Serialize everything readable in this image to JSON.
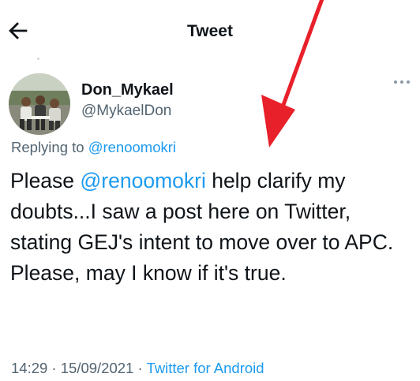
{
  "header": {
    "title": "Tweet",
    "back_icon": "back-arrow-icon"
  },
  "author": {
    "name": "Don_Mykael",
    "handle": "@MykaelDon",
    "avatar": "avatar-photo"
  },
  "more_icon": "more-options-icon",
  "reply": {
    "prefix": "Replying to ",
    "mention": "@renoomokri"
  },
  "tweet": {
    "pre": "Please ",
    "mention": "@renoomokri",
    "post": " help clarify my doubts...I saw a post here on Twitter, stating GEJ's intent to move over to APC. Please, may I know if it's true."
  },
  "meta": {
    "time": "14:29",
    "sep1": " · ",
    "date": "15/09/2021",
    "sep2": " · ",
    "source": "Twitter for Android"
  },
  "colors": {
    "link": "#1d9bf0",
    "secondary_text": "#536471",
    "annotation_arrow": "#e8202a"
  }
}
